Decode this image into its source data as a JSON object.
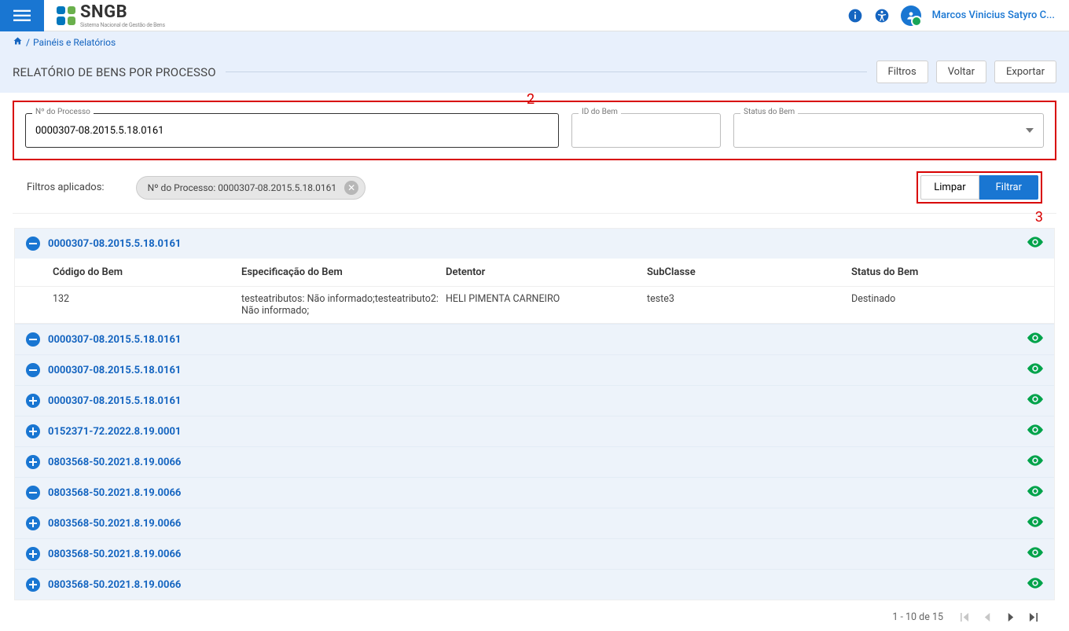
{
  "header": {
    "logo_text": "SNGB",
    "logo_sub": "Sistema Nacional de Gestão de Bens",
    "user_name": "Marcos Vinicius Satyro C..."
  },
  "breadcrumb": {
    "label": "Painéis e Relatórios"
  },
  "page": {
    "title": "RELATÓRIO DE BENS POR PROCESSO",
    "btn_filtros": "Filtros",
    "btn_voltar": "Voltar",
    "btn_exportar": "Exportar"
  },
  "filters": {
    "proc_label": "Nº do Processo",
    "proc_value": "0000307-08.2015.5.18.0161",
    "id_bem_label": "ID do Bem",
    "id_bem_value": "",
    "status_label": "Status do Bem"
  },
  "annotations": {
    "a2": "2",
    "a3": "3"
  },
  "chips": {
    "title": "Filtros aplicados:",
    "chip1": "Nº do Processo: 0000307-08.2015.5.18.0161",
    "btn_limpar": "Limpar",
    "btn_filtrar": "Filtrar"
  },
  "detail": {
    "h1": "Código do Bem",
    "h2": "Especificação do Bem",
    "h3": "Detentor",
    "h4": "SubClasse",
    "h5": "Status do Bem",
    "r_codigo": "132",
    "r_espec": "testeatributos: Não informado;testeatributo2: Não informado;",
    "r_det": "HELI PIMENTA CARNEIRO",
    "r_sub": "teste3",
    "r_status": "Destinado"
  },
  "rows": [
    {
      "id": "0000307-08.2015.5.18.0161",
      "expanded": true,
      "hasDetail": true
    },
    {
      "id": "0000307-08.2015.5.18.0161",
      "expanded": true,
      "hasDetail": false
    },
    {
      "id": "0000307-08.2015.5.18.0161",
      "expanded": true,
      "hasDetail": false
    },
    {
      "id": "0000307-08.2015.5.18.0161",
      "expanded": false,
      "hasDetail": false
    },
    {
      "id": "0152371-72.2022.8.19.0001",
      "expanded": false,
      "hasDetail": false
    },
    {
      "id": "0803568-50.2021.8.19.0066",
      "expanded": false,
      "hasDetail": false
    },
    {
      "id": "0803568-50.2021.8.19.0066",
      "expanded": true,
      "hasDetail": false
    },
    {
      "id": "0803568-50.2021.8.19.0066",
      "expanded": false,
      "hasDetail": false
    },
    {
      "id": "0803568-50.2021.8.19.0066",
      "expanded": false,
      "hasDetail": false
    },
    {
      "id": "0803568-50.2021.8.19.0066",
      "expanded": false,
      "hasDetail": false
    }
  ],
  "pager": {
    "range": "1 - 10 de 15"
  }
}
